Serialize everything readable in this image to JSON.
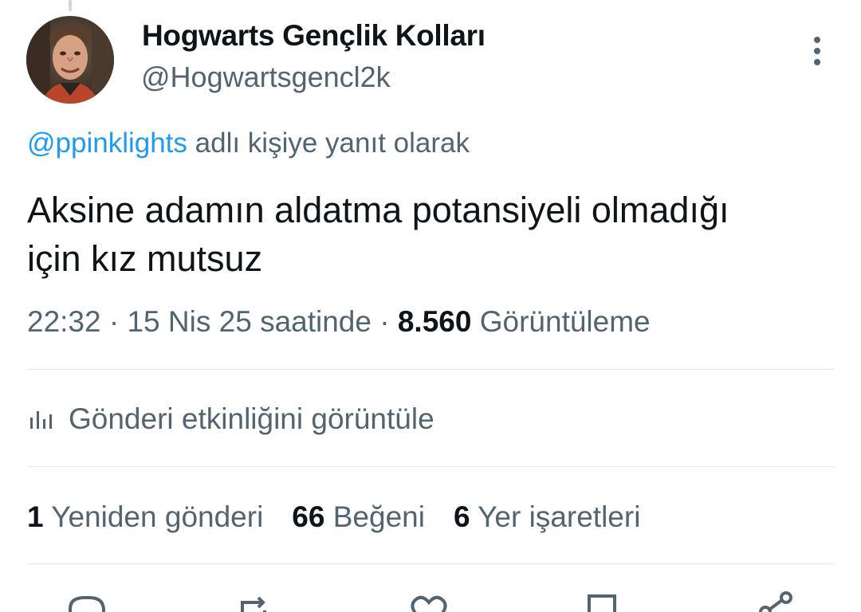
{
  "author": {
    "display_name": "Hogwarts Gençlik Kolları",
    "handle": "@Hogwartsgencl2k"
  },
  "reply": {
    "mention": "@ppinklights",
    "suffix": " adlı kişiye yanıt olarak"
  },
  "tweet": {
    "lines": [
      "Aksine adamın aldatma potansiyeli olmadığı",
      "için kız mutsuz"
    ]
  },
  "meta": {
    "time": "22:32",
    "separator1": " · ",
    "date": "15 Nis 25 saatinde",
    "separator2": " · ",
    "views_count": "8.560",
    "views_label": " Görüntüleme"
  },
  "activity": {
    "label": "Gönderi etkinliğini görüntüle"
  },
  "stats": {
    "reposts_count": "1",
    "reposts_label": " Yeniden gönderi",
    "likes_count": "66",
    "likes_label": " Beğeni",
    "bookmarks_count": "6",
    "bookmarks_label": " Yer işaretleri"
  },
  "icons": {
    "more": "more-vertical-icon",
    "analytics": "bar-chart-icon",
    "reply": "reply-icon",
    "repost": "repost-icon",
    "like": "heart-icon",
    "bookmark": "bookmark-icon",
    "share": "share-icon"
  },
  "colors": {
    "link": "#1d9bf0",
    "secondary_text": "#536471",
    "primary_text": "#0f1419",
    "divider": "#e1e8ed"
  }
}
